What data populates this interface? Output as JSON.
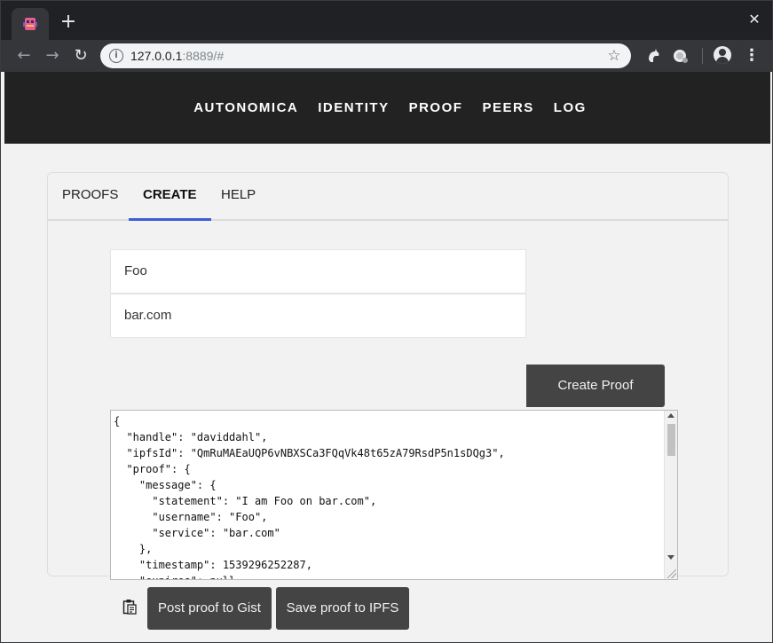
{
  "browser": {
    "url_host": "127.0.0.1",
    "url_rest": ":8889/#",
    "newtab_glyph": "+",
    "close_glyph": "✕",
    "back_glyph": "←",
    "forward_glyph": "→",
    "reload_glyph": "↻",
    "star_glyph": "☆",
    "menu_glyph": "⋮",
    "info_glyph": "i",
    "icons": [
      "app-favicon",
      "back-arrow-icon",
      "forward-arrow-icon",
      "reload-icon",
      "site-info-icon",
      "bookmark-star-icon",
      "extension-icon",
      "profile-icon",
      "menu-icon"
    ]
  },
  "site_nav": {
    "items": [
      {
        "label": "AUTONOMICA"
      },
      {
        "label": "IDENTITY"
      },
      {
        "label": "PROOF"
      },
      {
        "label": "PEERS"
      },
      {
        "label": "LOG"
      }
    ]
  },
  "tabs": [
    {
      "label": "PROOFS",
      "active": false
    },
    {
      "label": "CREATE",
      "active": true
    },
    {
      "label": "HELP",
      "active": false
    }
  ],
  "form": {
    "username_value": "Foo",
    "service_value": "bar.com",
    "create_label": "Create Proof",
    "json_text": "{\n  \"handle\": \"daviddahl\",\n  \"ipfsId\": \"QmRuMAEaUQP6vNBXSCa3FQqVk48t65zA79RsdP5n1sDQg3\",\n  \"proof\": {\n    \"message\": {\n      \"statement\": \"I am Foo on bar.com\",\n      \"username\": \"Foo\",\n      \"service\": \"bar.com\"\n    },\n    \"timestamp\": 1539296252287,\n    \"expires\": null",
    "gist_label": "Post proof to Gist",
    "ipfs_label": "Save proof to IPFS"
  },
  "colors": {
    "header_bg": "#222222",
    "button_bg": "#444444",
    "active_tab_underline": "#3f5bd6",
    "page_bg": "#f2f2f2"
  }
}
